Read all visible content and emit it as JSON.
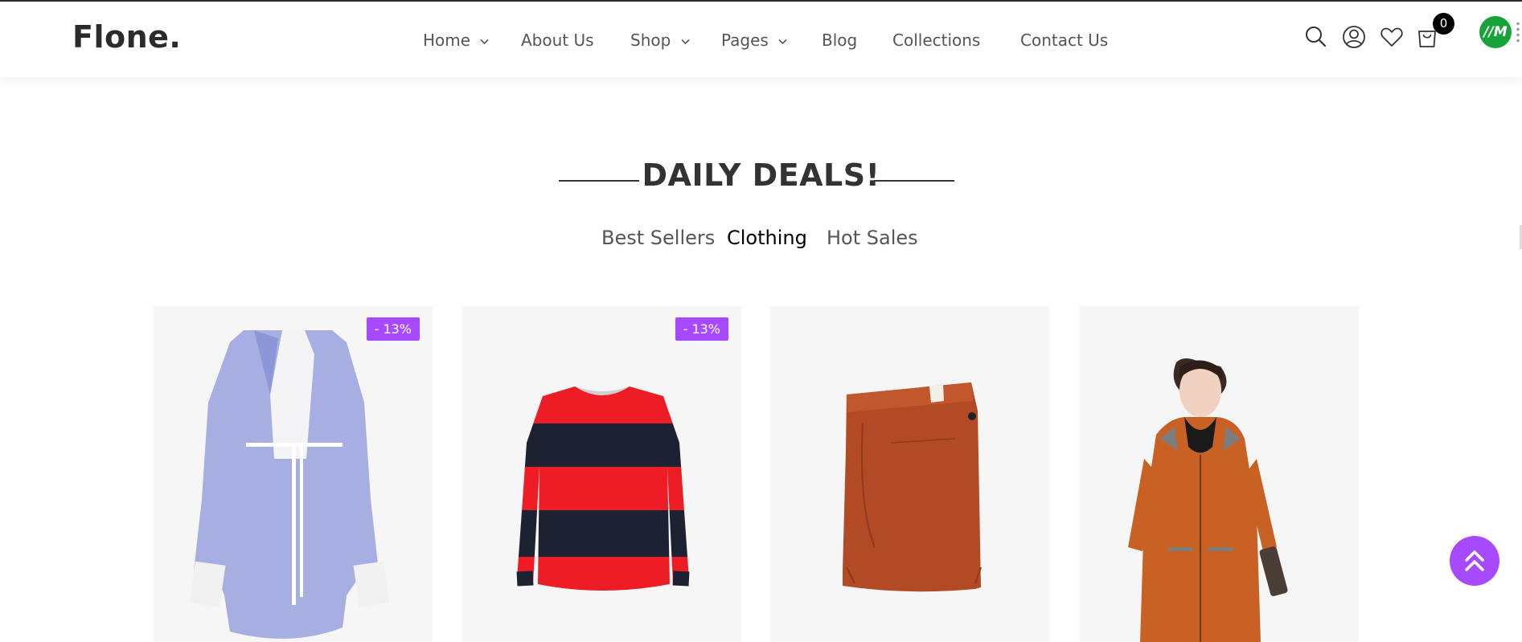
{
  "brand": {
    "logo": "Flone."
  },
  "nav": {
    "home": "Home",
    "about": "About Us",
    "shop": "Shop",
    "pages": "Pages",
    "blog": "Blog",
    "collections": "Collections",
    "contact": "Contact Us"
  },
  "header_icons": {
    "search": "search-icon",
    "account": "user-icon",
    "wishlist": "heart-icon",
    "cart": "cart-icon",
    "cart_count": "0"
  },
  "extension": {
    "label": "//M",
    "color": "#15a33a"
  },
  "section": {
    "title": "DAILY DEALS!",
    "tabs": {
      "best_sellers": "Best Sellers",
      "clothing": "Clothing",
      "hot_sales": "Hot Sales"
    },
    "active_tab": "Clothing"
  },
  "products": [
    {
      "image": "lavender shirt dress",
      "badge": "- 13%"
    },
    {
      "image": "red and navy striped sweater",
      "badge": "- 13%"
    },
    {
      "image": "rust chino trousers",
      "badge": ""
    },
    {
      "image": "woman in orange hooded jacket",
      "badge": ""
    }
  ],
  "scroll_top": {
    "icon": "double-chevron-up-icon"
  },
  "colors": {
    "accent": "#a749ff",
    "text": "#333333"
  }
}
